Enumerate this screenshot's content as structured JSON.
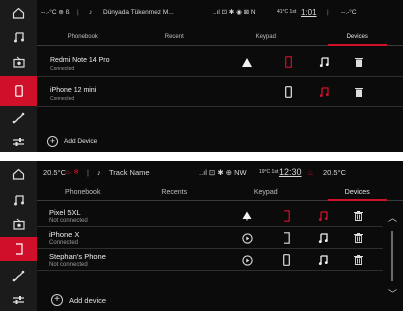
{
  "colors": {
    "accent": "#d0102b",
    "background": "#0b0b0b",
    "sidebar": "#1b1b1b"
  },
  "screen1": {
    "sidebar": [
      "home-icon",
      "music-icon",
      "media-radio-icon",
      "phone-icon",
      "navigation-icon",
      "settings-sliders-icon"
    ],
    "status": {
      "left": "--.-°C ⊕ ß",
      "now_playing": "Dünyada Tükenmez M...",
      "indicators": "..ıl ⊡ ✱ ◉ ⊠ N",
      "temp_small": "41°C 1st",
      "time": "1:01",
      "right_temp": "--.-°C"
    },
    "tabs": [
      {
        "label": "Phonebook",
        "active": false
      },
      {
        "label": "Recent",
        "active": false
      },
      {
        "label": "Keypad",
        "active": false
      },
      {
        "label": "Devices",
        "active": true
      }
    ],
    "devices": [
      {
        "name": "Redmi Note 14 Pro",
        "status": "Connected"
      },
      {
        "name": "iPhone 12 mini",
        "status": "Connected"
      }
    ],
    "add_device": "Add Device"
  },
  "screen2": {
    "sidebar": [
      "home-icon",
      "music-icon",
      "media-radio-icon",
      "phone-icon",
      "navigation-icon",
      "settings-sliders-icon"
    ],
    "status": {
      "left": "20.5°C",
      "now_playing": "Track Name",
      "indicators": "..ıl ⊡ ✱ ⊕ NW",
      "temp_small": "19°C 1st",
      "time": "12:30",
      "right_temp": "20.5°C"
    },
    "tabs": [
      {
        "label": "Phonebook",
        "active": false
      },
      {
        "label": "Recents",
        "active": false
      },
      {
        "label": "Keypad",
        "active": false
      },
      {
        "label": "Devices",
        "active": true
      }
    ],
    "devices": [
      {
        "name": "Pixel 5XL",
        "status": "Not connected"
      },
      {
        "name": "iPhone X",
        "status": "Connected"
      },
      {
        "name": "Stephan's Phone",
        "status": "Not connected"
      }
    ],
    "add_device": "Add device"
  }
}
